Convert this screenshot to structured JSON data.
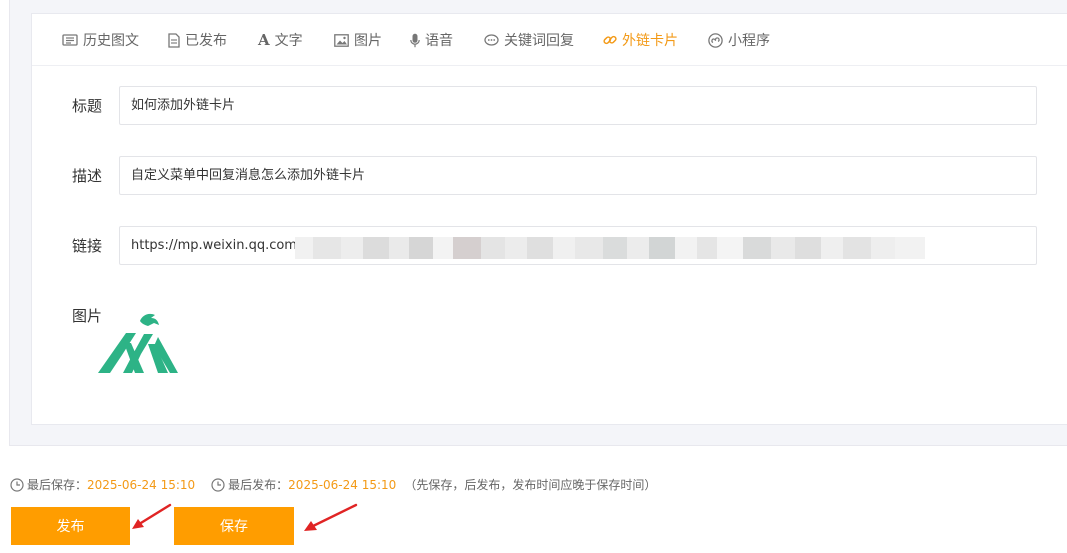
{
  "tabs": [
    {
      "label": "历史图文",
      "icon": "history-icon"
    },
    {
      "label": "已发布",
      "icon": "document-icon"
    },
    {
      "label": "文字",
      "icon": "text-icon"
    },
    {
      "label": "图片",
      "icon": "image-icon"
    },
    {
      "label": "语音",
      "icon": "microphone-icon"
    },
    {
      "label": "关键词回复",
      "icon": "chat-icon"
    },
    {
      "label": "外链卡片",
      "icon": "link-icon",
      "active": true
    },
    {
      "label": "小程序",
      "icon": "miniprogram-icon"
    }
  ],
  "form": {
    "title_label": "标题",
    "title_value": "如何添加外链卡片",
    "desc_label": "描述",
    "desc_value": "自定义菜单中回复消息怎么添加外链卡片",
    "link_label": "链接",
    "link_value": "https://mp.weixin.qq.com/",
    "image_label": "图片"
  },
  "footer": {
    "last_saved_label": "最后保存：",
    "last_saved_time": "2025-06-24 15:10",
    "last_published_label": "最后发布：",
    "last_published_time": "2025-06-24 15:10",
    "hint": "（先保存，后发布，发布时间应晚于保存时间）",
    "publish_label": "发布",
    "save_label": "保存"
  },
  "colors": {
    "accent": "#f39a17",
    "button": "#ff9d00",
    "logo": "#2db386",
    "annotation_arrow": "#e02424"
  }
}
